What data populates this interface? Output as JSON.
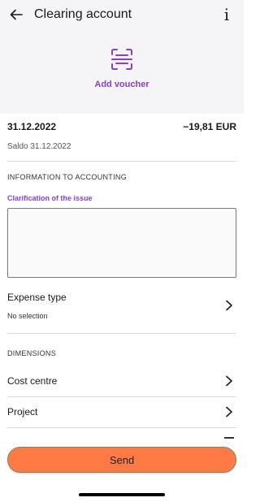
{
  "header": {
    "title": "Clearing account",
    "back_icon": "arrow-left-icon",
    "info_icon": "info-icon"
  },
  "voucher": {
    "label": "Add voucher",
    "icon": "scan-document-icon"
  },
  "transaction": {
    "date": "31.12.2022",
    "amount": "−19,81 EUR",
    "saldo": "Saldo 31.12.2022"
  },
  "accounting": {
    "section_title": "INFORMATION TO ACCOUNTING",
    "clarification_label": "Clarification of the issue",
    "clarification_value": ""
  },
  "expense_type": {
    "label": "Expense type",
    "value": "No selection"
  },
  "dimensions": {
    "section_title": "DIMENSIONS",
    "items": [
      {
        "label": "Cost centre"
      },
      {
        "label": "Project"
      }
    ]
  },
  "actions": {
    "send_label": "Send"
  },
  "colors": {
    "accent": "#8a3fd1",
    "send_button": "#ff7a45",
    "top_background": "#f5f5f7"
  }
}
